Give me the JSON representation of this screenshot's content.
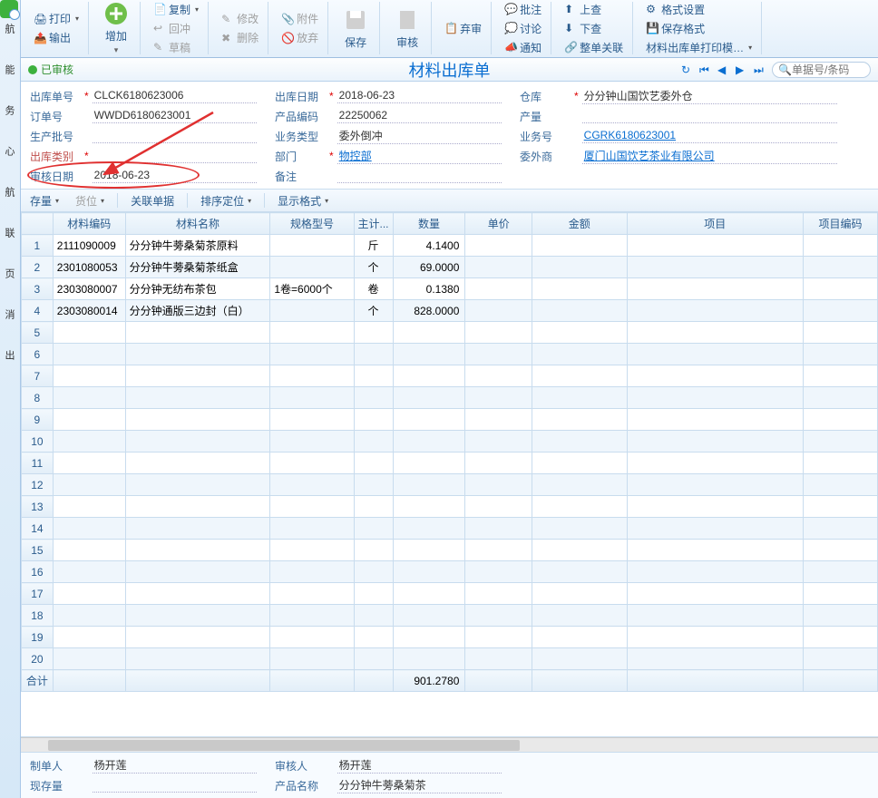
{
  "sidebar": {
    "items": [
      "航",
      "能",
      "务",
      "心",
      "航",
      "联",
      "页",
      "消",
      "出"
    ]
  },
  "ribbon": {
    "print": "打印",
    "output": "输出",
    "add": "增加",
    "copy": "复制",
    "rollback": "回冲",
    "draft": "草稿",
    "modify": "修改",
    "delete": "删除",
    "attachment": "附件",
    "discard": "放弃",
    "save": "保存",
    "audit": "审核",
    "abandonAudit": "弃审",
    "annotate": "批注",
    "discuss": "讨论",
    "notify": "通知",
    "checkUp": "上查",
    "checkDown": "下查",
    "linkAll": "整单关联",
    "formatSet": "格式设置",
    "saveFormat": "保存格式",
    "printTemplate": "材料出库单打印模…"
  },
  "status": {
    "audited": "已审核",
    "title": "材料出库单",
    "searchPlaceholder": "单据号/条码"
  },
  "header": {
    "l1": "出库单号",
    "v1": "CLCK6180623006",
    "l2": "出库日期",
    "v2": "2018-06-23",
    "l3": "仓库",
    "v3": "分分钟山国饮艺委外仓",
    "l4": "订单号",
    "v4": "WWDD6180623001",
    "l5": "产品编码",
    "v5": "22250062",
    "l6": "产量",
    "v6": "",
    "l7": "生产批号",
    "v7": "",
    "l8": "业务类型",
    "v8": "委外倒冲",
    "l9": "业务号",
    "v9": "CGRK6180623001",
    "l10": "出库类别",
    "v10": "",
    "l11": "部门",
    "v11": "物控部",
    "l12": "委外商",
    "v12": "厦门山国饮艺茶业有限公司",
    "l13": "审核日期",
    "v13": "2018-06-23",
    "l14": "备注",
    "v14": ""
  },
  "gridToolbar": {
    "stock": "存量",
    "location": "货位",
    "linkDoc": "关联单据",
    "sort": "排序定位",
    "display": "显示格式"
  },
  "columns": {
    "c0": "",
    "c1": "材料编码",
    "c2": "材料名称",
    "c3": "规格型号",
    "c4": "主计...",
    "c5": "数量",
    "c6": "单价",
    "c7": "金额",
    "c8": "项目",
    "c9": "项目编码"
  },
  "rows": [
    {
      "code": "2111090009",
      "name": "分分钟牛蒡桑菊茶原料",
      "spec": "",
      "unit": "斤",
      "qty": "4.1400"
    },
    {
      "code": "2301080053",
      "name": "分分钟牛蒡桑菊茶纸盒",
      "spec": "",
      "unit": "个",
      "qty": "69.0000"
    },
    {
      "code": "2303080007",
      "name": "分分钟无纺布茶包",
      "spec": "1卷=6000个",
      "unit": "卷",
      "qty": "0.1380"
    },
    {
      "code": "2303080014",
      "name": "分分钟通版三边封（白）",
      "spec": "",
      "unit": "个",
      "qty": "828.0000"
    }
  ],
  "totalRow": {
    "label": "合计",
    "qty": "901.2780"
  },
  "emptyRows": 16,
  "footer": {
    "l1": "制单人",
    "v1": "杨开莲",
    "l2": "审核人",
    "v2": "杨开莲",
    "l3": "现存量",
    "v3": "",
    "l4": "产品名称",
    "v4": "分分钟牛蒡桑菊茶"
  }
}
